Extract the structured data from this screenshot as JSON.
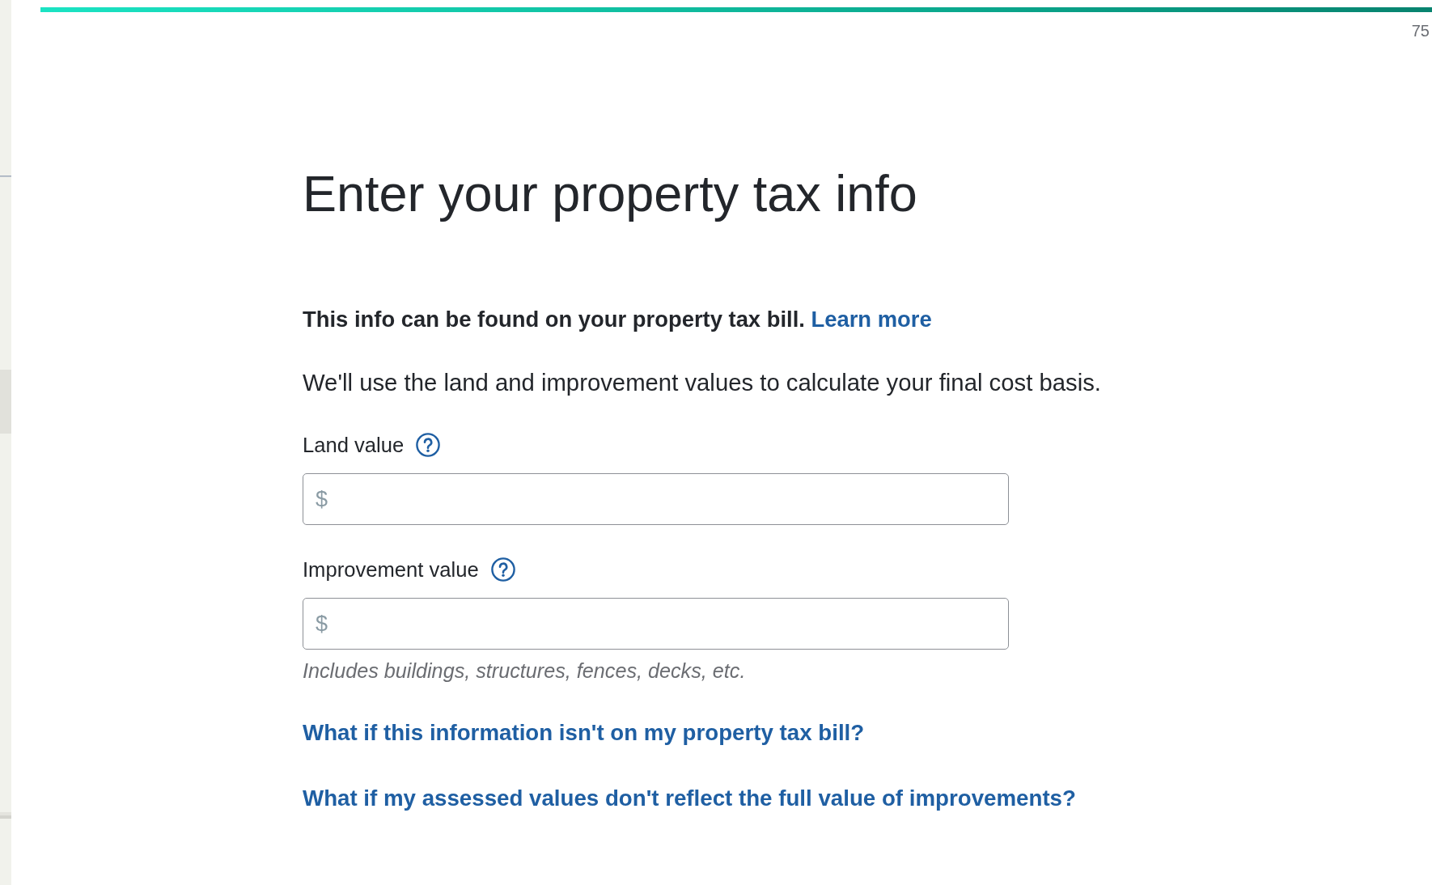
{
  "progress": {
    "level": 1,
    "label": "75"
  },
  "title": "Enter your property tax info",
  "intro": {
    "text": "This info can be found on your property tax bill.",
    "link": "Learn more"
  },
  "description": "We'll use the land and improvement values to calculate your final cost basis.",
  "fields": [
    {
      "label": "Land value",
      "help": true,
      "placeholder": "$"
    },
    {
      "label": "Improvement value",
      "help": true,
      "placeholder": "$",
      "hint": "Includes buildings, structures, fences, decks, etc."
    }
  ],
  "links": [
    "What if this information isn't on my property tax bill?",
    "What if my assessed values don't reflect the full value of improvements?"
  ]
}
